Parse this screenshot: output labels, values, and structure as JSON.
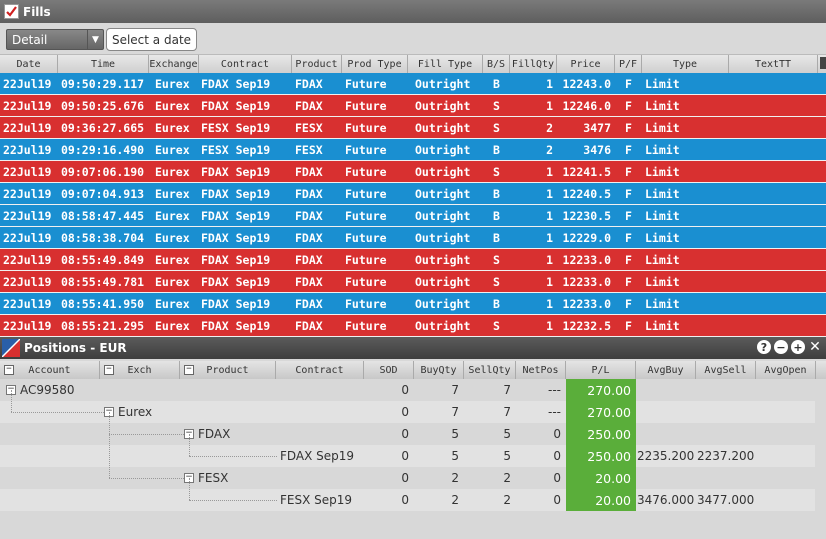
{
  "fills": {
    "title": "Fills",
    "view_select": "Detail",
    "date_button": "Select a date",
    "columns": [
      "Date",
      "Time",
      "Exchange",
      "Contract",
      "Product",
      "Prod Type",
      "Fill Type",
      "B/S",
      "FillQty",
      "Price",
      "P/F",
      "Type",
      "TextTT"
    ],
    "rows": [
      {
        "side": "buy",
        "date": "22Jul19",
        "time": "09:50:29.117",
        "exchange": "Eurex",
        "contract": "FDAX Sep19",
        "product": "FDAX",
        "prod_type": "Future",
        "fill_type": "Outright",
        "bs": "B",
        "qty": "1",
        "price": "12243.0",
        "pf": "F",
        "type": "Limit"
      },
      {
        "side": "sell",
        "date": "22Jul19",
        "time": "09:50:25.676",
        "exchange": "Eurex",
        "contract": "FDAX Sep19",
        "product": "FDAX",
        "prod_type": "Future",
        "fill_type": "Outright",
        "bs": "S",
        "qty": "1",
        "price": "12246.0",
        "pf": "F",
        "type": "Limit"
      },
      {
        "side": "sell",
        "date": "22Jul19",
        "time": "09:36:27.665",
        "exchange": "Eurex",
        "contract": "FESX Sep19",
        "product": "FESX",
        "prod_type": "Future",
        "fill_type": "Outright",
        "bs": "S",
        "qty": "2",
        "price": "3477",
        "pf": "F",
        "type": "Limit"
      },
      {
        "side": "buy",
        "date": "22Jul19",
        "time": "09:29:16.490",
        "exchange": "Eurex",
        "contract": "FESX Sep19",
        "product": "FESX",
        "prod_type": "Future",
        "fill_type": "Outright",
        "bs": "B",
        "qty": "2",
        "price": "3476",
        "pf": "F",
        "type": "Limit"
      },
      {
        "side": "sell",
        "date": "22Jul19",
        "time": "09:07:06.190",
        "exchange": "Eurex",
        "contract": "FDAX Sep19",
        "product": "FDAX",
        "prod_type": "Future",
        "fill_type": "Outright",
        "bs": "S",
        "qty": "1",
        "price": "12241.5",
        "pf": "F",
        "type": "Limit"
      },
      {
        "side": "buy",
        "date": "22Jul19",
        "time": "09:07:04.913",
        "exchange": "Eurex",
        "contract": "FDAX Sep19",
        "product": "FDAX",
        "prod_type": "Future",
        "fill_type": "Outright",
        "bs": "B",
        "qty": "1",
        "price": "12240.5",
        "pf": "F",
        "type": "Limit"
      },
      {
        "side": "buy",
        "date": "22Jul19",
        "time": "08:58:47.445",
        "exchange": "Eurex",
        "contract": "FDAX Sep19",
        "product": "FDAX",
        "prod_type": "Future",
        "fill_type": "Outright",
        "bs": "B",
        "qty": "1",
        "price": "12230.5",
        "pf": "F",
        "type": "Limit"
      },
      {
        "side": "buy",
        "date": "22Jul19",
        "time": "08:58:38.704",
        "exchange": "Eurex",
        "contract": "FDAX Sep19",
        "product": "FDAX",
        "prod_type": "Future",
        "fill_type": "Outright",
        "bs": "B",
        "qty": "1",
        "price": "12229.0",
        "pf": "F",
        "type": "Limit"
      },
      {
        "side": "sell",
        "date": "22Jul19",
        "time": "08:55:49.849",
        "exchange": "Eurex",
        "contract": "FDAX Sep19",
        "product": "FDAX",
        "prod_type": "Future",
        "fill_type": "Outright",
        "bs": "S",
        "qty": "1",
        "price": "12233.0",
        "pf": "F",
        "type": "Limit"
      },
      {
        "side": "sell",
        "date": "22Jul19",
        "time": "08:55:49.781",
        "exchange": "Eurex",
        "contract": "FDAX Sep19",
        "product": "FDAX",
        "prod_type": "Future",
        "fill_type": "Outright",
        "bs": "S",
        "qty": "1",
        "price": "12233.0",
        "pf": "F",
        "type": "Limit"
      },
      {
        "side": "buy",
        "date": "22Jul19",
        "time": "08:55:41.950",
        "exchange": "Eurex",
        "contract": "FDAX Sep19",
        "product": "FDAX",
        "prod_type": "Future",
        "fill_type": "Outright",
        "bs": "B",
        "qty": "1",
        "price": "12233.0",
        "pf": "F",
        "type": "Limit"
      },
      {
        "side": "sell",
        "date": "22Jul19",
        "time": "08:55:21.295",
        "exchange": "Eurex",
        "contract": "FDAX Sep19",
        "product": "FDAX",
        "prod_type": "Future",
        "fill_type": "Outright",
        "bs": "S",
        "qty": "1",
        "price": "12232.5",
        "pf": "F",
        "type": "Limit"
      }
    ]
  },
  "positions": {
    "title": "Positions - EUR",
    "controls": {
      "help": "?",
      "minimize": "−",
      "add": "+",
      "close": "✕"
    },
    "columns": [
      "Account",
      "Exch",
      "Product",
      "Contract",
      "SOD",
      "BuyQty",
      "SellQty",
      "NetPos",
      "P/L",
      "AvgBuy",
      "AvgSell",
      "AvgOpen"
    ],
    "rows": [
      {
        "level": 0,
        "account": "AC99580",
        "exch": "",
        "product": "",
        "contract": "",
        "sod": "0",
        "buy": "7",
        "sell": "7",
        "net": "---",
        "pl": "270.00",
        "avgbuy": "",
        "avgsell": ""
      },
      {
        "level": 1,
        "account": "",
        "exch": "Eurex",
        "product": "",
        "contract": "",
        "sod": "0",
        "buy": "7",
        "sell": "7",
        "net": "---",
        "pl": "270.00",
        "avgbuy": "",
        "avgsell": ""
      },
      {
        "level": 2,
        "account": "",
        "exch": "",
        "product": "FDAX",
        "contract": "",
        "sod": "0",
        "buy": "5",
        "sell": "5",
        "net": "0",
        "pl": "250.00",
        "avgbuy": "",
        "avgsell": ""
      },
      {
        "level": 3,
        "account": "",
        "exch": "",
        "product": "",
        "contract": "FDAX Sep19",
        "sod": "0",
        "buy": "5",
        "sell": "5",
        "net": "0",
        "pl": "250.00",
        "avgbuy": "2235.200",
        "avgsell": "2237.200"
      },
      {
        "level": 2,
        "account": "",
        "exch": "",
        "product": "FESX",
        "contract": "",
        "sod": "0",
        "buy": "2",
        "sell": "2",
        "net": "0",
        "pl": "20.00",
        "avgbuy": "",
        "avgsell": ""
      },
      {
        "level": 3,
        "account": "",
        "exch": "",
        "product": "",
        "contract": "FESX Sep19",
        "sod": "0",
        "buy": "2",
        "sell": "2",
        "net": "0",
        "pl": "20.00",
        "avgbuy": "3476.000",
        "avgsell": "3477.000"
      }
    ]
  },
  "colors": {
    "buy": "#1a8fd1",
    "sell": "#d83030",
    "pl_positive": "#5aae3a"
  }
}
